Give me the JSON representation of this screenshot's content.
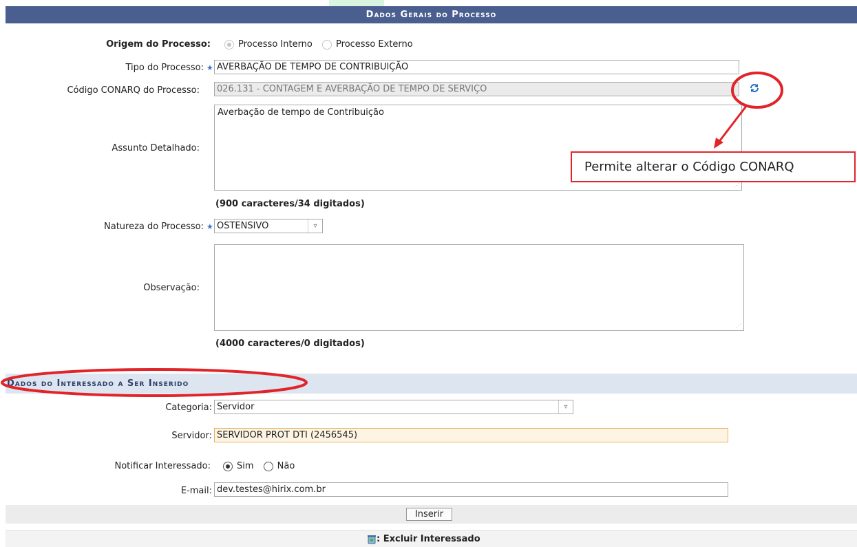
{
  "main_section": {
    "title": "Dados Gerais do Processo",
    "origem": {
      "label": "Origem do Processo:",
      "options": [
        "Processo Interno",
        "Processo Externo"
      ],
      "selected": "Processo Interno"
    },
    "tipo": {
      "label": "Tipo do Processo:",
      "value": "AVERBAÇÃO DE TEMPO DE CONTRIBUIÇÃO"
    },
    "conarq": {
      "label": "Código CONARQ do Processo:",
      "value": "026.131 - CONTAGEM E AVERBAÇÃO DE TEMPO DE SERVIÇO"
    },
    "assunto": {
      "label": "Assunto Detalhado:",
      "value": "Averbação de tempo de Contribuição",
      "counter": "(900 caracteres/34 digitados)"
    },
    "natureza": {
      "label": "Natureza do Processo:",
      "value": "OSTENSIVO"
    },
    "observacao": {
      "label": "Observação:",
      "value": "",
      "counter": "(4000 caracteres/0 digitados)"
    }
  },
  "interessado_section": {
    "title": "Dados do Interessado a Ser Inserido",
    "categoria": {
      "label": "Categoria:",
      "value": "Servidor"
    },
    "servidor": {
      "label": "Servidor:",
      "value": "SERVIDOR PROT DTI (2456545)"
    },
    "notificar": {
      "label": "Notificar Interessado:",
      "options": [
        "Sim",
        "Não"
      ],
      "selected": "Sim"
    },
    "email": {
      "label": "E-mail:",
      "value": "dev.testes@hirix.com.br"
    },
    "insert_button": "Inserir",
    "footer_legend": ": Excluir Interessado"
  },
  "annotation": {
    "text": "Permite alterar o Código CONARQ",
    "color": "#e0242a"
  },
  "icons": {
    "required": "required-star-icon",
    "refresh": "refresh-icon",
    "delete": "trash-icon"
  },
  "colors": {
    "header_bg": "#4a5f8f",
    "section_bg": "#dde5f0",
    "required_star": "#3a6fc4"
  }
}
